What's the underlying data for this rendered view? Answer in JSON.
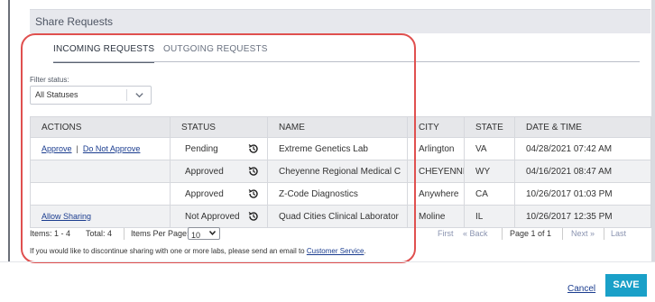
{
  "panel": {
    "title": "Share Requests"
  },
  "tabs": [
    {
      "label": "INCOMING REQUESTS",
      "active": true
    },
    {
      "label": "OUTGOING REQUESTS",
      "active": false
    }
  ],
  "filter": {
    "label": "Filter status:",
    "selected": "All Statuses"
  },
  "table": {
    "headers": [
      "ACTIONS",
      "STATUS",
      "NAME",
      "CITY",
      "STATE",
      "DATE & TIME"
    ],
    "rows": [
      {
        "actions": [
          "Approve",
          "Do Not Approve"
        ],
        "status": "Pending",
        "name": "Extreme Genetics Lab",
        "city": "Arlington",
        "state": "VA",
        "datetime": "04/28/2021 07:42 AM"
      },
      {
        "actions": [],
        "status": "Approved",
        "name": "Cheyenne Regional Medical C",
        "city": "CHEYENNE",
        "state": "WY",
        "datetime": "04/16/2021 08:47 AM"
      },
      {
        "actions": [],
        "status": "Approved",
        "name": "Z-Code Diagnostics",
        "city": "Anywhere",
        "state": "CA",
        "datetime": "10/26/2017 01:03 PM"
      },
      {
        "actions": [
          "Allow Sharing"
        ],
        "status": "Not Approved",
        "name": "Quad Cities Clinical Laborator",
        "city": "Moline",
        "state": "IL",
        "datetime": "10/26/2017 12:35 PM"
      }
    ]
  },
  "pager": {
    "items_label": "Items: 1 - 4",
    "total_label": "Total: 4",
    "per_page_label": "Items Per Page:",
    "per_page_value": "10",
    "first": "First",
    "back": "« Back",
    "page_info": "Page 1 of 1",
    "next": "Next »",
    "last": "Last"
  },
  "notice": {
    "text": "If you would like to discontinue sharing with one or more labs, please send an email to ",
    "link": "Customer Service",
    "end": "."
  },
  "footer": {
    "cancel": "Cancel",
    "save": "SAVE"
  },
  "colors": {
    "accent": "#1aa0c8",
    "highlight": "#e0504f",
    "link": "#1a3c8f"
  },
  "icons": {
    "history": "history-icon",
    "dropdown": "chevron-down-icon"
  }
}
